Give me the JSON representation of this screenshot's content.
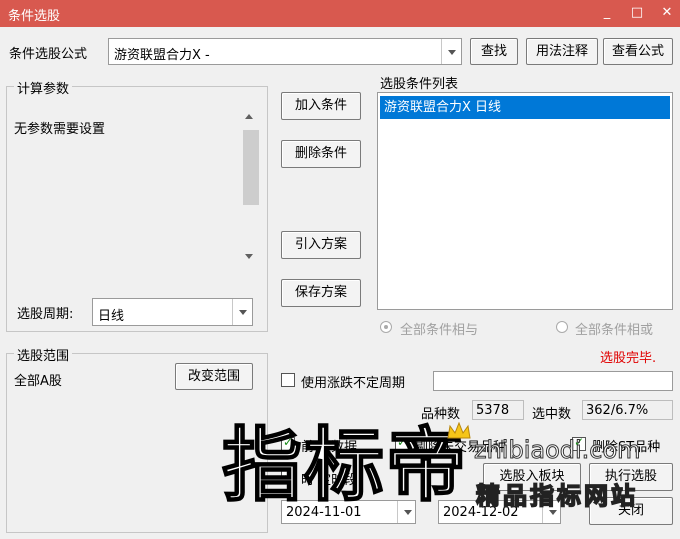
{
  "window": {
    "title": "条件选股",
    "minimize_glyph": "_",
    "maximize_glyph": "□",
    "close_glyph": "✕"
  },
  "formula": {
    "label": "条件选股公式",
    "value": "游资联盟合力X  -",
    "find_button": "查找",
    "usage_button": "用法注释",
    "view_button": "查看公式"
  },
  "params": {
    "group_title": "计算参数",
    "no_params_text": "无参数需要设置",
    "period_label": "选股周期:",
    "period_value": "日线"
  },
  "actions": {
    "add_condition": "加入条件",
    "delete_condition": "删除条件",
    "import_scheme": "引入方案",
    "save_scheme": "保存方案"
  },
  "condition_list": {
    "label": "选股条件列表",
    "items": [
      "游资联盟合力X  日线"
    ],
    "radio_and": "全部条件相与",
    "radio_or": "全部条件相或",
    "status": "选股完毕."
  },
  "range": {
    "group_title": "选股范围",
    "value": "全部A股",
    "change_button": "改变范围"
  },
  "options": {
    "uncertain_period_label": "使用涨跌不定周期",
    "uncertain_period_value": "",
    "stock_count_label": "品种数",
    "stock_count_value": "5378",
    "selected_label": "选中数",
    "selected_value": "362/6.7%",
    "chk_prev_data_label": "前  权数据",
    "chk_exclude_label": "剔除未交易品种",
    "chk_delete_st_label": "删除ST品种",
    "chk_time_range_label": "时  定时段",
    "to_board_button": "选股入板块",
    "execute_button": "执行选股",
    "close_button": "关闭",
    "date_from": "2024-11-01",
    "date_to": "2024-12-02"
  },
  "watermark": {
    "big_text": "指标帝",
    "url": "zhibiaodi.com",
    "slogan": "精品指标网站"
  },
  "colors": {
    "titlebar": "#d8594f",
    "selection": "#0078d7",
    "status_text": "#e00000"
  }
}
